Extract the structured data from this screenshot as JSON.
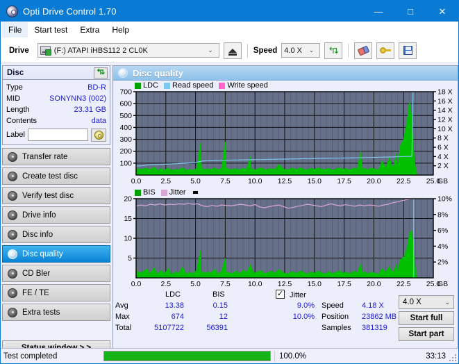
{
  "window": {
    "title": "Opti Drive Control 1.70",
    "icon": "disc-icon",
    "minimize": "—",
    "maximize": "□",
    "close": "✕"
  },
  "menu": {
    "items": [
      {
        "label": "File",
        "active": true
      },
      {
        "label": "Start test",
        "active": false
      },
      {
        "label": "Extra",
        "active": false
      },
      {
        "label": "Help",
        "active": false
      }
    ]
  },
  "toolbar": {
    "drive_label": "Drive",
    "drive_value": "(F:)  ATAPI iHBS112  2 CL0K",
    "eject_icon": "eject-icon",
    "speed_label": "Speed",
    "speed_value": "4.0 X",
    "refresh_icon": "refresh-icon",
    "eraser_icon": "eraser-icon",
    "key_icon": "key-icon",
    "save_icon": "save-icon",
    "caret": "⌄"
  },
  "sidebar": {
    "disc_panel": {
      "title": "Disc",
      "refresh_icon": "refresh-icon",
      "rows": [
        {
          "key": "Type",
          "value": "BD-R"
        },
        {
          "key": "MID",
          "value": "SONYNN3 (002)"
        },
        {
          "key": "Length",
          "value": "23.31 GB"
        },
        {
          "key": "Contents",
          "value": "data"
        }
      ],
      "label_key": "Label",
      "label_value": "",
      "label_placeholder": "",
      "disc_icon": "cd-icon"
    },
    "nav_items": [
      {
        "label": "Transfer rate",
        "selected": false
      },
      {
        "label": "Create test disc",
        "selected": false
      },
      {
        "label": "Verify test disc",
        "selected": false
      },
      {
        "label": "Drive info",
        "selected": false
      },
      {
        "label": "Disc info",
        "selected": false
      },
      {
        "label": "Disc quality",
        "selected": true
      },
      {
        "label": "CD Bler",
        "selected": false
      },
      {
        "label": "FE / TE",
        "selected": false
      },
      {
        "label": "Extra tests",
        "selected": false
      }
    ],
    "status_window_button": "Status window > >"
  },
  "content": {
    "header": "Disc quality",
    "header_icon": "disc-quality-icon"
  },
  "stats": {
    "col_headers": [
      "LDC",
      "BIS"
    ],
    "row_headers": [
      "Avg",
      "Max",
      "Total"
    ],
    "ldc": {
      "avg": "13.38",
      "max": "674",
      "total": "5107722"
    },
    "bis": {
      "avg": "0.15",
      "max": "12",
      "total": "56391"
    },
    "jitter": {
      "label": "Jitter",
      "checked": true,
      "check_glyph": "✓",
      "avg": "9.0%",
      "max": "10.0%"
    },
    "speed_label": "Speed",
    "speed_value": "4.18 X",
    "position_label": "Position",
    "position_value": "23862 MB",
    "samples_label": "Samples",
    "samples_value": "381319",
    "speed_select": "4.0 X",
    "speed_select_caret": "⌄",
    "start_full": "Start full",
    "start_part": "Start part"
  },
  "statusbar": {
    "text": "Test completed",
    "progress_percent": "100.0%",
    "progress_value": 100,
    "elapsed": "33:13"
  },
  "colors": {
    "title_bar": "#0a7bd4",
    "ldc_green": "#00a000",
    "bis_green": "#00c000",
    "read_speed": "#7ec8f0",
    "write_speed": "#ff66cc",
    "jitter_pink": "#d9a8d9",
    "plot_bg": "#667089",
    "panel_bg": "#eceefc",
    "value_blue": "#1a1ad0",
    "progress_green": "#16b316"
  },
  "chart_data": [
    {
      "type": "line",
      "name": "disc-quality-ldc-chart",
      "title": "",
      "xlabel": "GB",
      "ylabel": "",
      "xlim": [
        0.0,
        25.0
      ],
      "xticks": [
        "0.0",
        "2.5",
        "5.0",
        "7.5",
        "10.0",
        "12.5",
        "15.0",
        "17.5",
        "20.0",
        "22.5",
        "25.0"
      ],
      "xunit": "GB",
      "ylim": [
        0,
        700
      ],
      "yticks": [
        "100",
        "200",
        "300",
        "400",
        "500",
        "600",
        "700"
      ],
      "y2lim": [
        0,
        18
      ],
      "y2ticks": [
        "2 X",
        "4 X",
        "6 X",
        "8 X",
        "10 X",
        "12 X",
        "14 X",
        "16 X",
        "18 X"
      ],
      "grid": true,
      "legend_position": "top-left",
      "legend": [
        {
          "label": "LDC",
          "color": "#00a000"
        },
        {
          "label": "Read speed",
          "color": "#7ec8f0"
        },
        {
          "label": "Write speed",
          "color": "#ff66cc"
        }
      ],
      "series": [
        {
          "name": "LDC",
          "type": "area",
          "color": "#00c000",
          "x": [
            0.0,
            0.3,
            0.6,
            0.9,
            1.2,
            1.5,
            1.8,
            2.1,
            2.4,
            2.7,
            3.0,
            3.3,
            3.6,
            3.9,
            4.2,
            4.5,
            4.8,
            5.1,
            5.4,
            5.5,
            5.7,
            6.0,
            6.3,
            6.6,
            6.9,
            7.2,
            7.5,
            7.55,
            7.8,
            8.1,
            8.4,
            8.7,
            9.0,
            9.3,
            9.6,
            9.65,
            9.9,
            10.2,
            10.5,
            10.8,
            11.1,
            11.4,
            11.7,
            12.0,
            12.3,
            12.6,
            12.9,
            13.2,
            13.5,
            13.8,
            14.1,
            14.4,
            14.7,
            15.0,
            15.3,
            15.6,
            15.9,
            16.2,
            16.5,
            16.8,
            17.1,
            17.4,
            17.7,
            18.0,
            18.3,
            18.6,
            18.9,
            19.0,
            19.2,
            19.5,
            19.8,
            20.1,
            20.4,
            20.7,
            21.0,
            21.3,
            21.6,
            21.9,
            22.0,
            22.2,
            22.5,
            22.8,
            23.0,
            23.2,
            23.35,
            23.5,
            23.6
          ],
          "y": [
            60,
            48,
            52,
            58,
            45,
            68,
            40,
            55,
            42,
            60,
            38,
            50,
            44,
            62,
            40,
            48,
            42,
            55,
            265,
            70,
            46,
            52,
            48,
            60,
            44,
            58,
            278,
            62,
            50,
            46,
            55,
            42,
            60,
            48,
            155,
            58,
            44,
            52,
            62,
            46,
            50,
            55,
            48,
            90,
            60,
            44,
            52,
            58,
            46,
            62,
            50,
            44,
            56,
            48,
            60,
            52,
            46,
            58,
            44,
            50,
            62,
            48,
            55,
            44,
            60,
            52,
            200,
            48,
            58,
            44,
            60,
            50,
            46,
            120,
            58,
            150,
            52,
            180,
            66,
            240,
            300,
            460,
            620,
            480,
            200,
            60,
            20
          ]
        },
        {
          "name": "Read speed",
          "type": "line",
          "color": "#7ec8f0",
          "x": [
            0.0,
            0.5,
            1.0,
            1.5,
            2.0,
            3.0,
            4.0,
            5.0,
            5.6,
            6.5,
            7.5,
            8.5,
            9.5,
            10.5,
            11.5,
            12.5,
            13.5,
            14.5,
            15.5,
            16.5,
            17.5,
            18.5,
            19.5,
            20.5,
            21.5,
            22.5,
            23.2,
            23.3,
            23.4
          ],
          "y": [
            1.95,
            2.0,
            2.2,
            2.25,
            2.3,
            2.4,
            2.55,
            2.7,
            3.05,
            3.1,
            3.2,
            3.25,
            3.3,
            3.35,
            3.4,
            3.45,
            3.5,
            3.55,
            3.6,
            3.65,
            3.68,
            3.72,
            3.8,
            3.85,
            3.9,
            4.0,
            4.05,
            18.0,
            18.0
          ],
          "axis": "right"
        },
        {
          "name": "Write speed",
          "type": "line",
          "color": "#ff66cc",
          "x": [],
          "y": [],
          "axis": "right"
        }
      ]
    },
    {
      "type": "line",
      "name": "disc-quality-bis-jitter-chart",
      "title": "",
      "xlabel": "GB",
      "ylabel": "",
      "xlim": [
        0.0,
        25.0
      ],
      "xticks": [
        "0.0",
        "2.5",
        "5.0",
        "7.5",
        "10.0",
        "12.5",
        "15.0",
        "17.5",
        "20.0",
        "22.5",
        "25.0"
      ],
      "xunit": "GB",
      "ylim": [
        0,
        20
      ],
      "yticks": [
        "5",
        "10",
        "15",
        "20"
      ],
      "y2lim": [
        0,
        10
      ],
      "y2ticks": [
        "2%",
        "4%",
        "6%",
        "8%",
        "10%"
      ],
      "grid": true,
      "legend_position": "top-left",
      "legend": [
        {
          "label": "BIS",
          "color": "#00a000"
        },
        {
          "label": "Jitter",
          "color": "#d9a8d9"
        }
      ],
      "series": [
        {
          "name": "BIS",
          "type": "area",
          "color": "#00c000",
          "x": [
            0.0,
            0.3,
            0.6,
            0.9,
            1.2,
            1.5,
            1.8,
            2.1,
            2.4,
            2.7,
            3.0,
            3.3,
            3.6,
            3.9,
            4.2,
            4.5,
            4.8,
            5.1,
            5.4,
            5.45,
            5.7,
            6.0,
            6.3,
            6.6,
            6.9,
            7.2,
            7.5,
            7.55,
            7.8,
            8.1,
            8.4,
            8.7,
            9.0,
            9.3,
            9.6,
            9.9,
            10.2,
            10.5,
            10.8,
            11.1,
            11.4,
            11.7,
            12.0,
            12.3,
            12.6,
            12.9,
            13.2,
            13.5,
            13.8,
            14.1,
            14.4,
            14.7,
            15.0,
            15.3,
            15.6,
            15.9,
            16.2,
            16.5,
            16.8,
            17.1,
            17.4,
            17.7,
            18.0,
            18.3,
            18.6,
            18.9,
            19.0,
            19.2,
            19.5,
            19.8,
            20.1,
            20.4,
            20.7,
            21.0,
            21.3,
            21.6,
            21.9,
            22.0,
            22.2,
            22.5,
            22.8,
            23.0,
            23.2,
            23.35,
            23.5,
            23.6
          ],
          "y": [
            2.0,
            1.2,
            1.6,
            2.3,
            1.0,
            2.6,
            0.9,
            1.9,
            1.1,
            2.4,
            0.8,
            1.5,
            1.2,
            2.8,
            1.0,
            1.4,
            1.1,
            2.0,
            6.9,
            1.8,
            1.2,
            1.5,
            1.3,
            2.2,
            1.0,
            1.7,
            4.9,
            1.6,
            1.3,
            1.1,
            1.8,
            1.0,
            2.0,
            1.4,
            3.3,
            1.2,
            1.5,
            1.9,
            1.1,
            1.4,
            1.7,
            1.2,
            2.2,
            1.5,
            1.0,
            1.3,
            1.6,
            1.1,
            1.8,
            1.4,
            1.0,
            1.5,
            1.2,
            1.7,
            1.3,
            1.0,
            1.6,
            1.1,
            1.4,
            1.8,
            1.2,
            1.5,
            1.0,
            1.7,
            1.3,
            3.6,
            1.2,
            1.6,
            1.0,
            1.5,
            1.2,
            1.0,
            2.4,
            1.4,
            2.9,
            1.2,
            3.4,
            1.5,
            4.6,
            5.2,
            7.6,
            11.4,
            12.0,
            7.0,
            2.4,
            0.5
          ]
        },
        {
          "name": "Jitter",
          "type": "line",
          "color": "#d9a8d9",
          "x": [
            0.0,
            0.4,
            0.8,
            1.2,
            1.6,
            2.0,
            2.4,
            2.8,
            3.2,
            3.6,
            4.0,
            4.4,
            4.8,
            5.2,
            5.6,
            6.0,
            6.4,
            6.8,
            7.2,
            7.6,
            8.0,
            8.4,
            8.8,
            9.2,
            9.6,
            10.0,
            10.4,
            10.8,
            11.2,
            11.6,
            12.0,
            12.4,
            12.8,
            13.2,
            13.6,
            14.0,
            14.4,
            14.8,
            15.2,
            15.6,
            16.0,
            16.4,
            16.8,
            17.2,
            17.6,
            18.0,
            18.4,
            18.8,
            19.2,
            19.6,
            20.0,
            20.4,
            20.8,
            21.2,
            21.6,
            22.0,
            22.4,
            22.8,
            23.0,
            23.2,
            23.3
          ],
          "y": [
            9.1,
            9.2,
            9.1,
            9.3,
            9.2,
            9.35,
            9.2,
            9.3,
            9.25,
            9.35,
            9.3,
            9.4,
            9.3,
            9.35,
            9.1,
            9.0,
            9.15,
            9.05,
            9.2,
            9.15,
            9.1,
            9.2,
            9.3,
            9.2,
            9.1,
            9.25,
            8.95,
            8.85,
            9.0,
            9.1,
            9.2,
            9.0,
            8.8,
            8.9,
            9.05,
            9.15,
            9.3,
            9.2,
            9.1,
            9.0,
            9.2,
            9.35,
            9.2,
            9.1,
            9.25,
            9.15,
            9.05,
            9.2,
            9.1,
            9.2,
            9.15,
            9.05,
            9.2,
            9.3,
            9.5,
            9.6,
            9.75,
            9.9,
            9.95,
            10.0,
            10.0
          ],
          "axis": "right"
        },
        {
          "name": "Read speed marker",
          "type": "line",
          "color": "#7ec8f0",
          "x": [
            23.35,
            23.35
          ],
          "y": [
            0.0,
            10.0
          ],
          "axis": "right"
        }
      ]
    }
  ]
}
